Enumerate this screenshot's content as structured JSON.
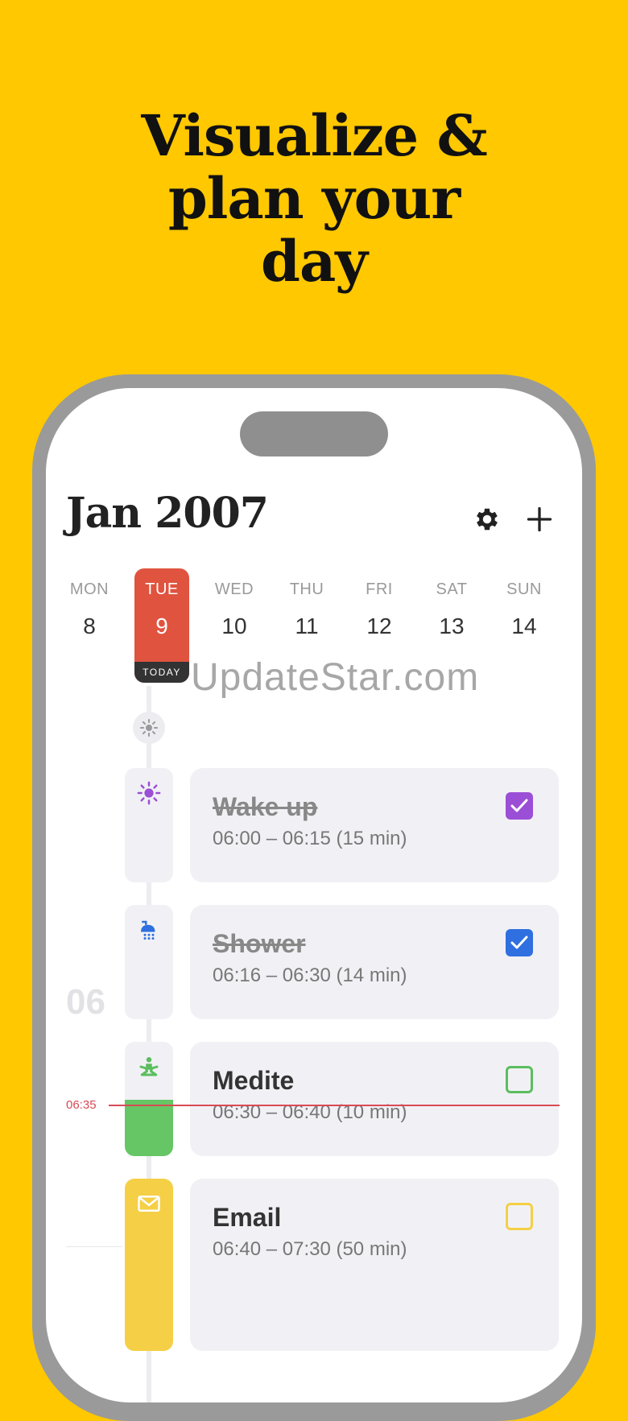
{
  "headline": [
    "Visualize &",
    "plan your",
    "day"
  ],
  "app": {
    "month_title": "Jan 2007",
    "icons": {
      "settings": "gear-icon",
      "add": "plus-icon"
    },
    "week": [
      {
        "dow": "MON",
        "day": "8"
      },
      {
        "dow": "TUE",
        "day": "9",
        "today": true
      },
      {
        "dow": "WED",
        "day": "10"
      },
      {
        "dow": "THU",
        "day": "11"
      },
      {
        "dow": "FRI",
        "day": "12"
      },
      {
        "dow": "SAT",
        "day": "13"
      },
      {
        "dow": "SUN",
        "day": "14"
      }
    ],
    "today_tag": "TODAY",
    "watermark": "UpdateStar.com",
    "hour_label": "06",
    "now_label": "06:35",
    "tasks": [
      {
        "title": "Wake up",
        "time": "06:00 – 06:15 (15 min)",
        "done": true,
        "color": "#9B4FD6",
        "icon": "sun-icon"
      },
      {
        "title": "Shower",
        "time": "06:16 – 06:30 (14 min)",
        "done": true,
        "color": "#2F6FE0",
        "icon": "shower-icon"
      },
      {
        "title": "Medite",
        "time": "06:30 – 06:40 (10 min)",
        "done": false,
        "color": "#5BBE5E",
        "icon": "meditation-icon"
      },
      {
        "title": "Email",
        "time": "06:40 – 07:30 (50 min)",
        "done": false,
        "color": "#F5CF45",
        "icon": "envelope-icon"
      }
    ],
    "colors": {
      "background": "#FFC800",
      "today": "#E0533F",
      "now_line": "#D84A55"
    }
  }
}
